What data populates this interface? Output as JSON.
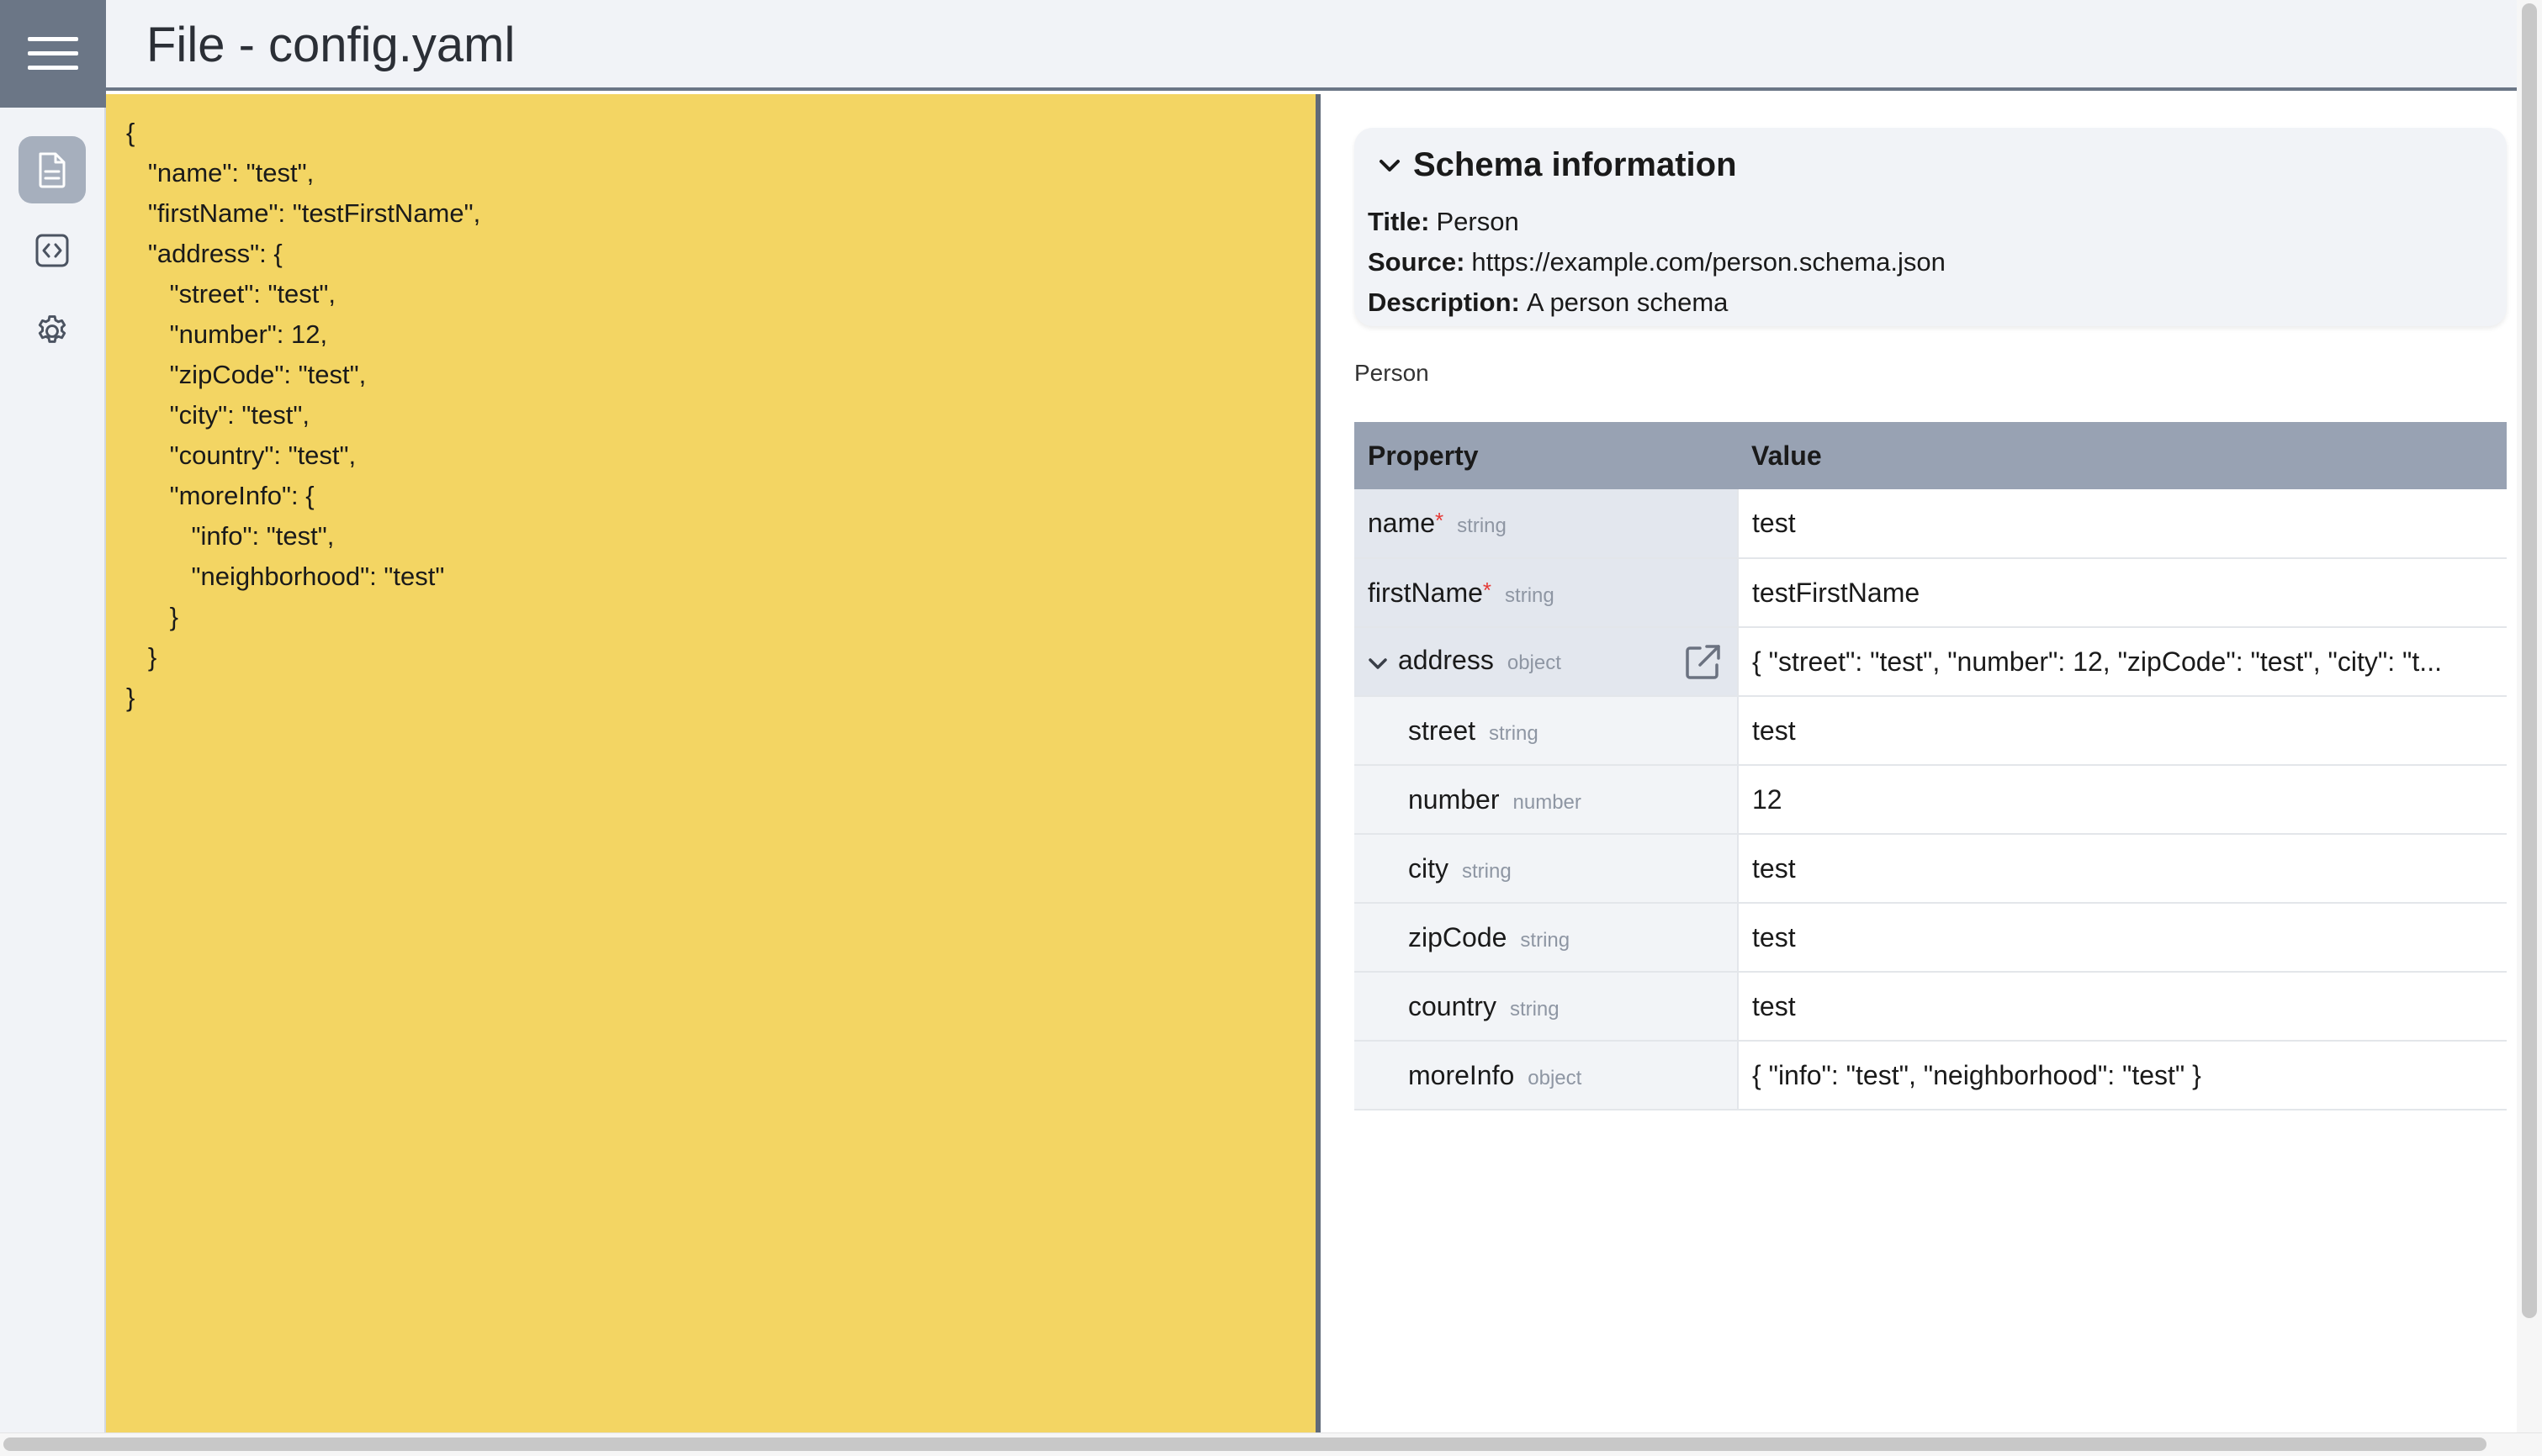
{
  "window": {
    "title": "File - config.yaml"
  },
  "sidebar": {
    "icons": [
      "hamburger-menu-icon",
      "document-icon",
      "code-icon",
      "gear-icon"
    ],
    "accent": "#6b7686"
  },
  "editor": {
    "background": "#f3d563",
    "content": "{\n   \"name\": \"test\",\n   \"firstName\": \"testFirstName\",\n   \"address\": {\n      \"street\": \"test\",\n      \"number\": 12,\n      \"zipCode\": \"test\",\n      \"city\": \"test\",\n      \"country\": \"test\",\n      \"moreInfo\": {\n         \"info\": \"test\",\n         \"neighborhood\": \"test\"\n      }\n   }\n}"
  },
  "schema": {
    "heading": "Schema information",
    "title_label": "Title:",
    "title_value": "Person",
    "source_label": "Source:",
    "source_value": "https://example.com/person.schema.json",
    "description_label": "Description:",
    "description_value": "A person schema"
  },
  "table": {
    "caption": "Person",
    "headers": {
      "property": "Property",
      "value": "Value"
    },
    "rows": [
      {
        "name": "name",
        "required": "*",
        "type": "string",
        "value": "test"
      },
      {
        "name": "firstName",
        "required": "*",
        "type": "string",
        "value": "testFirstName"
      },
      {
        "name": "address",
        "type": "object",
        "value": "{ \"street\": \"test\", \"number\": 12, \"zipCode\": \"test\", \"city\": \"t..."
      },
      {
        "name": "street",
        "type": "string",
        "value": "test"
      },
      {
        "name": "number",
        "type": "number",
        "value": "12"
      },
      {
        "name": "city",
        "type": "string",
        "value": "test"
      },
      {
        "name": "zipCode",
        "type": "string",
        "value": "test"
      },
      {
        "name": "country",
        "type": "string",
        "value": "test"
      },
      {
        "name": "moreInfo",
        "type": "object",
        "value": "{ \"info\": \"test\", \"neighborhood\": \"test\" }"
      }
    ]
  }
}
